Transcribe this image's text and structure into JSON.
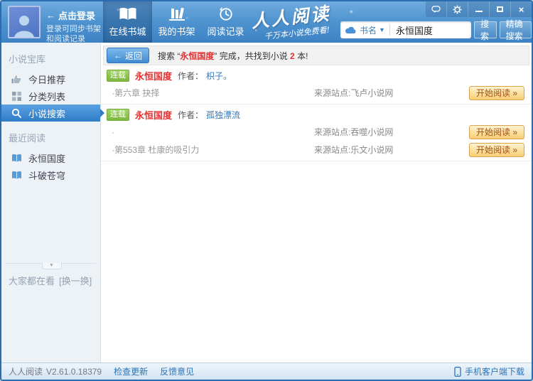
{
  "header": {
    "login": {
      "title": "点击登录",
      "subtitle_line1": "登录可同步书架",
      "subtitle_line2": "和阅读记录"
    },
    "tabs": [
      {
        "label": "在线书城",
        "icon": "open-book",
        "active": true
      },
      {
        "label": "我的书架",
        "icon": "bookshelf",
        "active": false
      },
      {
        "label": "阅读记录",
        "icon": "clock-history",
        "active": false
      }
    ],
    "logo": {
      "title": "人人阅读",
      "slogan": "千万本小说免费看!"
    },
    "search": {
      "category": "书名",
      "value": "永恒国度",
      "search_label": "搜索",
      "exact_search_label": "精确搜索"
    },
    "window_icons": [
      "chat-bubble",
      "gear",
      "minimize",
      "maximize",
      "close"
    ]
  },
  "sidebar": {
    "sections": [
      {
        "title": "小说宝库",
        "items": [
          {
            "label": "今日推荐",
            "icon": "thumb-up",
            "active": false
          },
          {
            "label": "分类列表",
            "icon": "grid",
            "active": false
          },
          {
            "label": "小说搜索",
            "icon": "magnifier",
            "active": true
          }
        ]
      },
      {
        "title": "最近阅读",
        "items": [
          {
            "label": "永恒国度",
            "icon": "book",
            "active": false
          },
          {
            "label": "斗破苍穹",
            "icon": "book",
            "active": false
          }
        ]
      }
    ],
    "recommend": {
      "label": "大家都在看",
      "action": "[换一换]"
    }
  },
  "main": {
    "back_label": "返回",
    "summary": {
      "prefix": "搜索 “",
      "keyword": "永恒国度",
      "middle": "” 完成，共找到小说 ",
      "count": "2",
      "suffix": " 本!"
    },
    "results": [
      {
        "badge": "连载",
        "title": "永恒国度",
        "author_label": "作者：",
        "author": "枳子。",
        "rows": [
          {
            "chapter": "·第六章 抉择",
            "source_label": "来源站点:",
            "source": "飞卢小说网",
            "action": "开始阅读 »"
          }
        ]
      },
      {
        "badge": "连载",
        "title": "永恒国度",
        "author_label": "作者：",
        "author": "孤独漂流",
        "rows": [
          {
            "chapter": "·",
            "source_label": "来源站点:",
            "source": "吞噬小说网",
            "action": "开始阅读 »"
          },
          {
            "chapter": "·第553章 杜康的吸引力",
            "source_label": "来源站点:",
            "source": "乐文小说网",
            "action": "开始阅读 »"
          }
        ]
      }
    ]
  },
  "statusbar": {
    "app_name": "人人阅读",
    "version": "V2.61.0.18379",
    "check_update": "检查更新",
    "feedback": "反馈意见",
    "mobile_download": "手机客户端下载"
  },
  "colors": {
    "header_blue": "#4e93cf",
    "accent_blue": "#2f7cc6",
    "title_red": "#e43030",
    "badge_green": "#7cb83e",
    "button_orange": "#f8cd74",
    "link_blue": "#2c74b8"
  }
}
